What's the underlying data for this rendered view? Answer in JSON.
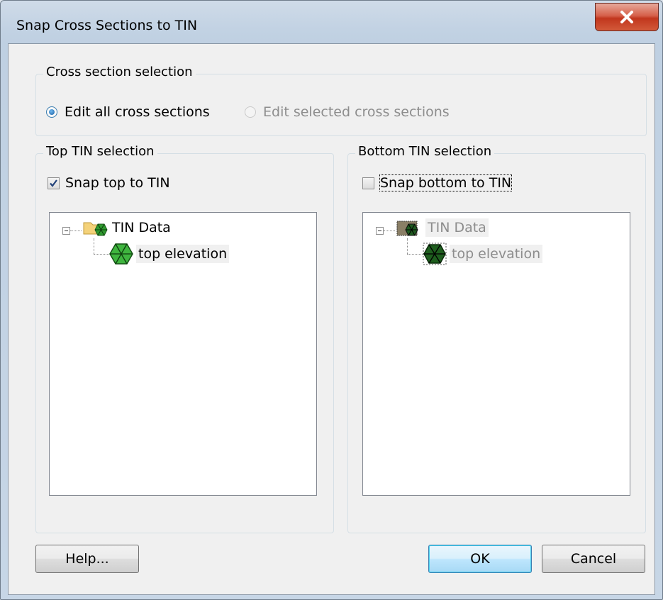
{
  "window": {
    "title": "Snap Cross Sections to TIN"
  },
  "cross_section": {
    "legend": "Cross section selection",
    "option_all": "Edit all cross sections",
    "option_selected": "Edit selected cross sections"
  },
  "top_tin": {
    "legend": "Top TIN selection",
    "checkbox_label": "Snap top to TIN",
    "checked": true,
    "tree": {
      "root": "TIN Data",
      "child": "top elevation"
    }
  },
  "bottom_tin": {
    "legend": "Bottom TIN selection",
    "checkbox_label": "Snap bottom to TIN",
    "checked": false,
    "tree": {
      "root": "TIN Data",
      "child": "top elevation"
    }
  },
  "buttons": {
    "help": "Help...",
    "ok": "OK",
    "cancel": "Cancel"
  }
}
